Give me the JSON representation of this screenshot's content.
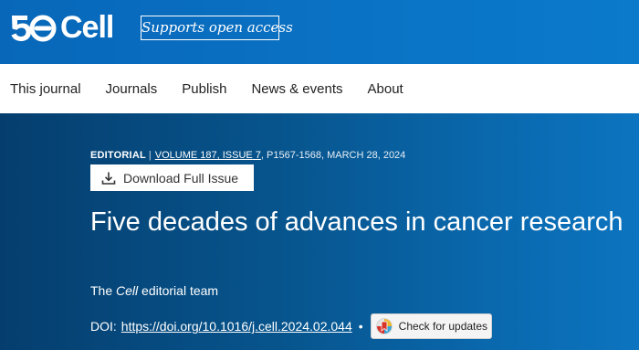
{
  "brand": {
    "logo_number": "50",
    "logo_text": "Cell",
    "open_access_badge": "Supports open access"
  },
  "nav": {
    "items": [
      "This journal",
      "Journals",
      "Publish",
      "News & events",
      "About"
    ]
  },
  "article": {
    "type": "EDITORIAL",
    "separator": "|",
    "issue": "VOLUME 187, ISSUE 7",
    "pages_date": ", P1567-1568, MARCH 28, 2024",
    "download_label": "Download Full Issue",
    "title": "Five decades of advances in cancer research",
    "authors_prefix": "The",
    "authors_journal": "Cell",
    "authors_suffix": "editorial team",
    "doi_label": "DOI:",
    "doi_url": "https://doi.org/10.1016/j.cell.2024.02.044",
    "bullet": "•",
    "check_updates_label": "Check for updates"
  },
  "colors": {
    "brand_blue": "#0a72c4",
    "hero_dark": "#053e6e",
    "hero_light": "#0c74c0"
  },
  "icons": {
    "download": "download-icon",
    "check_updates": "crossmark-icon"
  }
}
